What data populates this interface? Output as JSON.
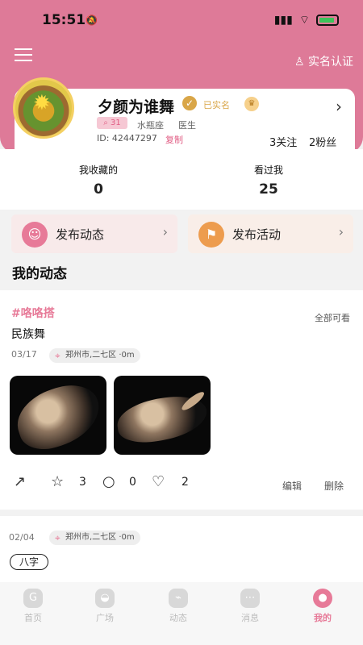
{
  "status": {
    "time": "15:51"
  },
  "header": {
    "verify_link": "实名认证"
  },
  "profile": {
    "username": "夕颜为谁舞",
    "real_name": "已实名",
    "badge": "31",
    "zodiac": "水瓶座",
    "job": "医生",
    "id": "ID: 42447297",
    "copy": "复制",
    "following": "3关注",
    "fans": "2粉丝"
  },
  "stats": [
    {
      "label": "我收藏的",
      "value": "0"
    },
    {
      "label": "看过我",
      "value": "25"
    }
  ],
  "actions": [
    {
      "label": "发布动态"
    },
    {
      "label": "发布活动"
    }
  ],
  "section_title": "我的动态",
  "post": {
    "tag": "#咯咯搭",
    "visibility": "全部可看",
    "text": "民族舞",
    "date": "03/17",
    "location": "郑州市,二七区 ·0m",
    "stars": "3",
    "comments": "0",
    "likes": "2",
    "edit": "编辑",
    "delete": "删除"
  },
  "post2": {
    "date": "02/04",
    "location": "郑州市,二七区 ·0m",
    "tag": "八字"
  },
  "tabs": [
    {
      "label": "首页"
    },
    {
      "label": "广场"
    },
    {
      "label": "动态"
    },
    {
      "label": "消息"
    },
    {
      "label": "我的"
    }
  ]
}
